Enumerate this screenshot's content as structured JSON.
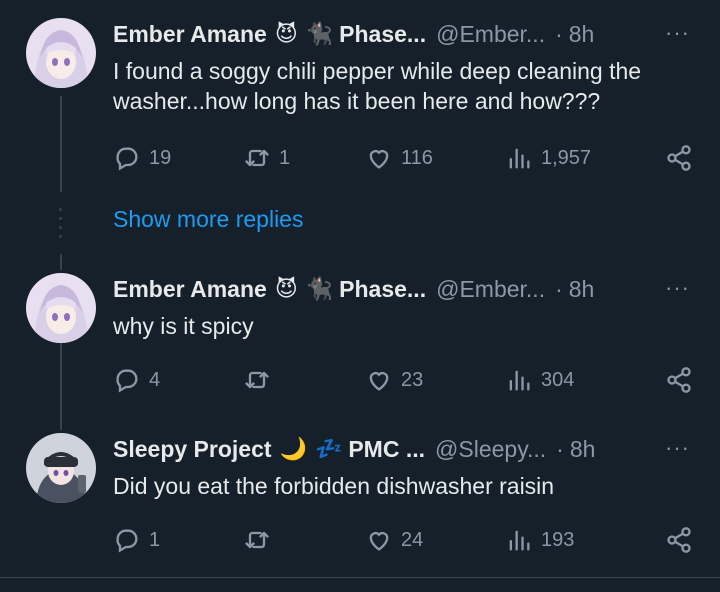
{
  "colors": {
    "background": "#15202b",
    "text": "#e7e9ea",
    "muted": "#8b98a5",
    "link": "#1d9bf0",
    "thread_line": "#38444d"
  },
  "tweets": [
    {
      "name": "Ember Amane",
      "emoji1": "😈",
      "emoji2": "🐈‍⬛",
      "badge": "Phase...",
      "handle": "@Ember...",
      "dot": "·",
      "time": "8h",
      "more": "···",
      "text": "I found a soggy chili pepper while deep cleaning the washer...how long has it been here and how???",
      "replies": "19",
      "retweets": "1",
      "likes": "116",
      "views": "1,957"
    },
    {
      "name": "Ember Amane",
      "emoji1": "😈",
      "emoji2": "🐈‍⬛",
      "badge": "Phase...",
      "handle": "@Ember...",
      "dot": "·",
      "time": "8h",
      "more": "···",
      "text": "why is it spicy",
      "replies": "4",
      "retweets": "",
      "likes": "23",
      "views": "304"
    },
    {
      "name": "Sleepy Project",
      "emoji1": "🌙",
      "emoji2": "💤",
      "badge": "PMC ...",
      "handle": "@Sleepy...",
      "dot": "·",
      "time": "8h",
      "more": "···",
      "text": "Did you eat the forbidden dishwasher raisin",
      "replies": "1",
      "retweets": "",
      "likes": "24",
      "views": "193"
    }
  ],
  "show_more": "Show more replies"
}
